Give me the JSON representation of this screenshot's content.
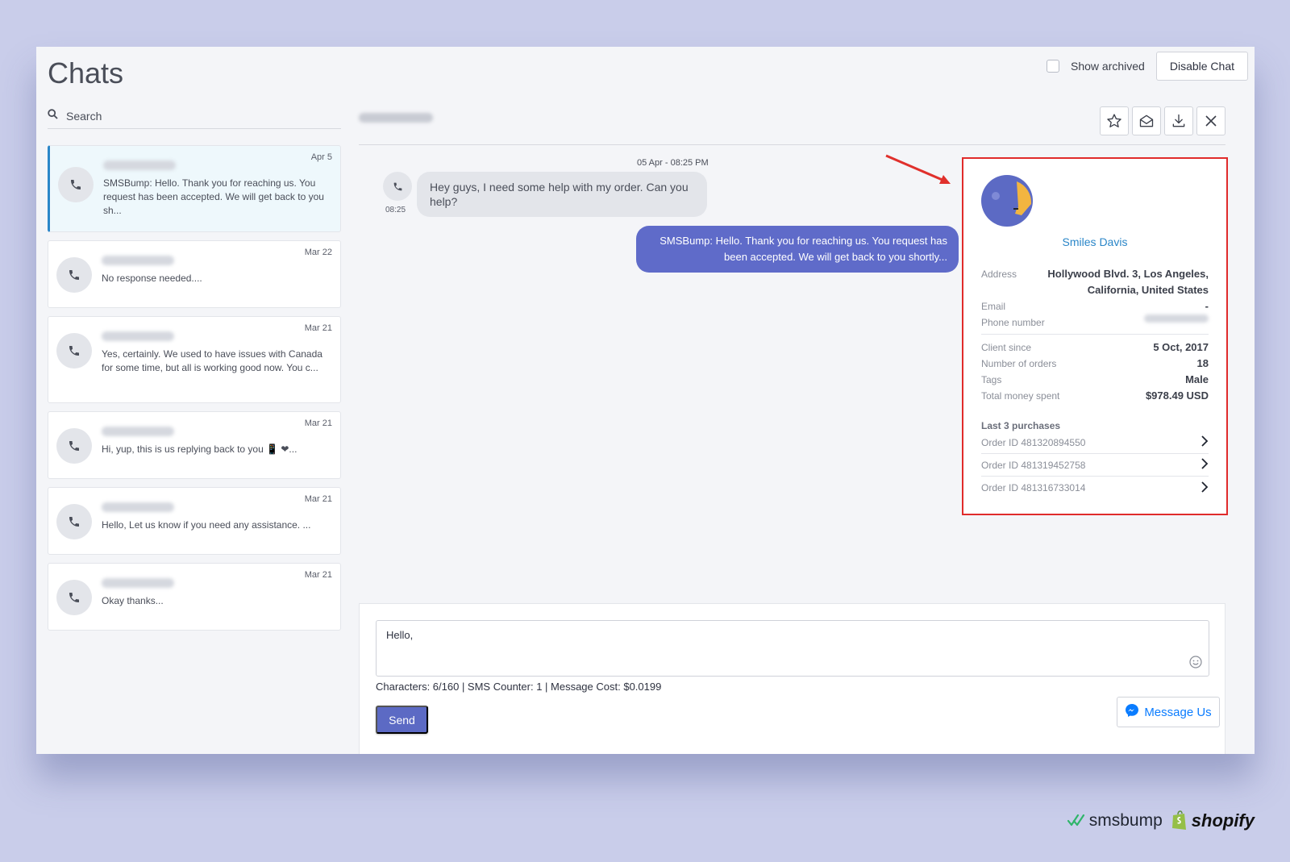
{
  "app": {
    "title": "Chats"
  },
  "top_bar": {
    "show_archived_label": "Show archived",
    "disable_chat_label": "Disable Chat"
  },
  "search": {
    "placeholder": "Search"
  },
  "chats": [
    {
      "date": "Apr 5",
      "preview": "SMSBump: Hello. Thank you for reaching us. You request has been accepted. We will get back to you sh..."
    },
    {
      "date": "Mar 22",
      "preview": "No response needed...."
    },
    {
      "date": "Mar 21",
      "preview": "Yes, certainly. We used to have issues with Canada for some time, but all is working good now. You c..."
    },
    {
      "date": "Mar 21",
      "preview": "Hi, yup, this is us replying back to you 📱 ❤..."
    },
    {
      "date": "Mar 21",
      "preview": "Hello, Let us know if you need any assistance. ..."
    },
    {
      "date": "Mar 21",
      "preview": "Okay thanks..."
    }
  ],
  "conversation": {
    "timestamp": "05 Apr - 08:25 PM",
    "incoming": {
      "time": "08:25",
      "text": "Hey guys, I need some help with my order. Can you help?"
    },
    "outgoing": {
      "text": "SMSBump: Hello. Thank you for reaching us. You request has been accepted. We will get back to you shortly..."
    }
  },
  "customer": {
    "name": "Smiles Davis",
    "fields": {
      "address_label": "Address",
      "address": "Hollywood Blvd. 3, Los Angeles, California, United States",
      "email_label": "Email",
      "email": "-",
      "phone_label": "Phone number",
      "client_since_label": "Client since",
      "client_since": "5 Oct, 2017",
      "orders_label": "Number of orders",
      "orders": "18",
      "tags_label": "Tags",
      "tags": "Male",
      "spent_label": "Total money spent",
      "spent": "$978.49 USD"
    },
    "purchases_title": "Last 3 purchases",
    "purchases": [
      {
        "label": "Order ID 481320894550"
      },
      {
        "label": "Order ID 481319452758"
      },
      {
        "label": "Order ID 481316733014"
      }
    ]
  },
  "composer": {
    "value": "Hello,",
    "counter": "Characters: 6/160 | SMS Counter: 1 | Message Cost: $0.0199",
    "send_label": "Send",
    "message_us_label": "Message Us"
  },
  "branding": {
    "smsbump": "smsbump",
    "shopify": "shopify"
  },
  "colors": {
    "accent": "#5c6ac4",
    "highlight_border": "#e02b2b",
    "link": "#2a86c8",
    "background": "#c9cdea"
  }
}
